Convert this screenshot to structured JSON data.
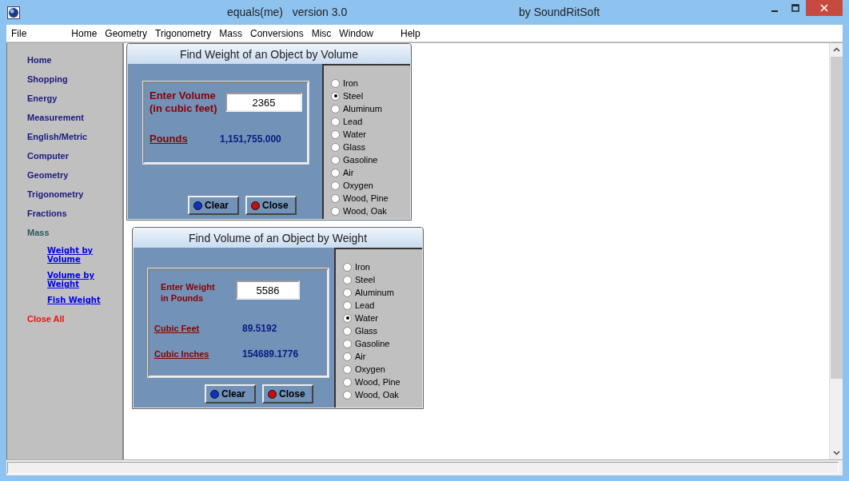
{
  "window": {
    "title": "equals(me)   version 3.0",
    "brand": "by SoundRitSoft"
  },
  "menu": [
    "File",
    "Home",
    "Geometry",
    "Trigonometry",
    "Mass",
    "Conversions",
    "Misc",
    "Window",
    "Help"
  ],
  "sidebar": {
    "items": [
      {
        "label": "Home",
        "kind": "main"
      },
      {
        "label": "Shopping",
        "kind": "main"
      },
      {
        "label": "Energy",
        "kind": "main"
      },
      {
        "label": "Measurement",
        "kind": "main"
      },
      {
        "label": "English/Metric",
        "kind": "main"
      },
      {
        "label": "Computer",
        "kind": "main"
      },
      {
        "label": "Geometry",
        "kind": "main"
      },
      {
        "label": "Trigonometry",
        "kind": "main"
      },
      {
        "label": "Fractions",
        "kind": "main"
      },
      {
        "label": "Mass",
        "kind": "current"
      },
      {
        "label": "Weight by Volume",
        "kind": "sub"
      },
      {
        "label": "Volume by Weight",
        "kind": "sub"
      },
      {
        "label": "Fish Weight",
        "kind": "sub"
      },
      {
        "label": "Close All",
        "kind": "close"
      }
    ]
  },
  "forms": [
    {
      "title": "Find Weight of an Object by Volume",
      "input_label": [
        "Enter Volume",
        "(in cubic feet)"
      ],
      "value": "2365",
      "results": [
        {
          "label": "Pounds",
          "value": "1,151,755.000"
        }
      ],
      "buttons": [
        {
          "label": "Clear",
          "color": "#1030c0"
        },
        {
          "label": "Close",
          "color": "#c01010"
        }
      ],
      "materials": [
        {
          "label": "Iron",
          "selected": false
        },
        {
          "label": "Steel",
          "selected": true
        },
        {
          "label": "Aluminum",
          "selected": false
        },
        {
          "label": "Lead",
          "selected": false
        },
        {
          "label": "Water",
          "selected": false
        },
        {
          "label": "Glass",
          "selected": false
        },
        {
          "label": "Gasoline",
          "selected": false
        },
        {
          "label": "Air",
          "selected": false
        },
        {
          "label": "Oxygen",
          "selected": false
        },
        {
          "label": "Wood, Pine",
          "selected": false
        },
        {
          "label": "Wood, Oak",
          "selected": false
        }
      ]
    },
    {
      "title": "Find Volume of an Object by Weight",
      "input_label": [
        "Enter Weight",
        "in Pounds"
      ],
      "value": "5586",
      "results": [
        {
          "label": "Cubic Feet",
          "value": "89.5192"
        },
        {
          "label": "Cubic Inches",
          "value": "154689.1776"
        }
      ],
      "buttons": [
        {
          "label": "Clear",
          "color": "#1030c0"
        },
        {
          "label": "Close",
          "color": "#c01010"
        }
      ],
      "materials": [
        {
          "label": "Iron",
          "selected": false
        },
        {
          "label": "Steel",
          "selected": false
        },
        {
          "label": "Aluminum",
          "selected": false
        },
        {
          "label": "Lead",
          "selected": false
        },
        {
          "label": "Water",
          "selected": true
        },
        {
          "label": "Glass",
          "selected": false
        },
        {
          "label": "Gasoline",
          "selected": false
        },
        {
          "label": "Air",
          "selected": false
        },
        {
          "label": "Oxygen",
          "selected": false
        },
        {
          "label": "Wood, Pine",
          "selected": false
        },
        {
          "label": "Wood, Oak",
          "selected": false
        }
      ]
    }
  ]
}
